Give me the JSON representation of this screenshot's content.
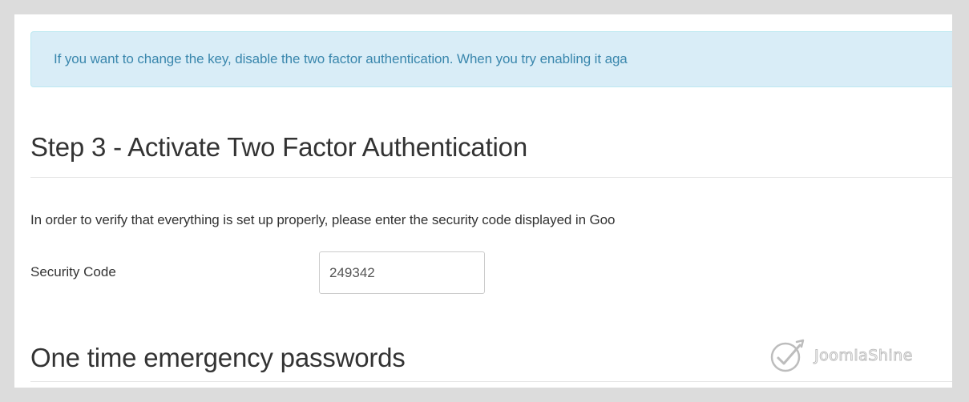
{
  "alert": {
    "text": "If you want to change the key, disable the two factor authentication. When you try enabling it aga"
  },
  "step3": {
    "title": "Step 3 - Activate Two Factor Authentication",
    "intro": "In order to verify that everything is set up properly, please enter the security code displayed in Goo",
    "security_code_label": "Security Code",
    "security_code_value": "249342"
  },
  "emergency": {
    "title": "One time emergency passwords"
  },
  "watermark": {
    "text": "JoomlaShine",
    "icon": "joomlashine-logo-icon"
  }
}
